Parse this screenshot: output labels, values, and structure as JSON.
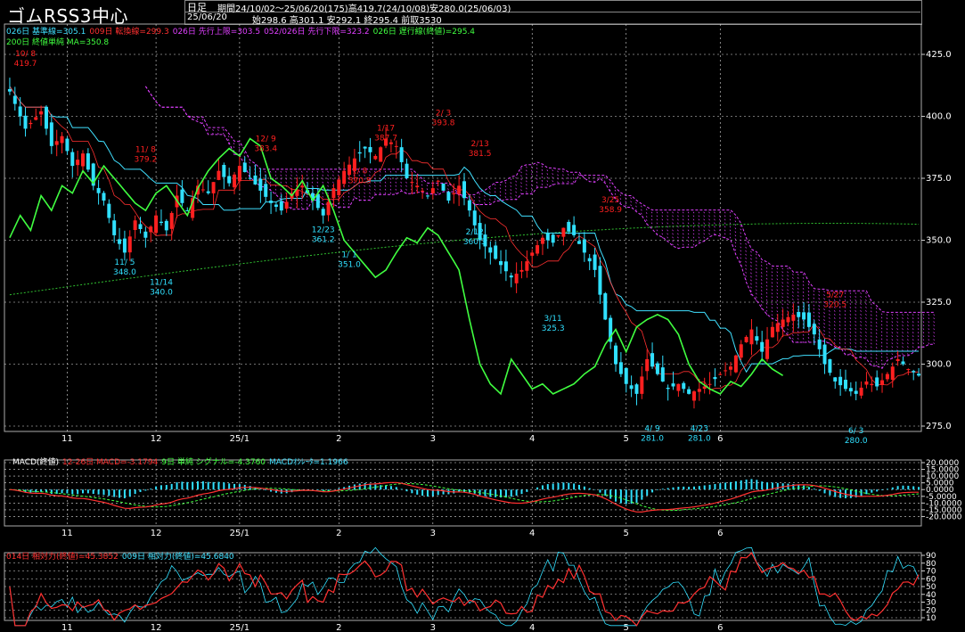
{
  "app": {
    "title": "ゴムRSS3中心",
    "bar_type": "日足",
    "summary_line1": "期間24/10/02～25/06/20(175)高419.7(24/10/08)安280.0(25/06/03)",
    "date": "25/06/20",
    "summary_line2": "始298.6 高301.1 安292.1 終295.4 前取3530"
  },
  "legend": {
    "main_row1": [
      {
        "text": "026日 基準線=305.1",
        "color": "#40e0ff"
      },
      {
        "text": "009日 転換線=299.3",
        "color": "#ff3030"
      },
      {
        "text": "026日 先行上限=303.5",
        "color": "#e040ff"
      },
      {
        "text": "052/026日 先行下限=323.2",
        "color": "#e040ff"
      },
      {
        "text": "026日 遅行線(終値)=295.4",
        "color": "#40ff40"
      }
    ],
    "main_row2": [
      {
        "text": "200日 終値単純 MA=350.8",
        "color": "#40ff40"
      }
    ],
    "macd": [
      {
        "text": "MACD(終値)",
        "color": "#ffffff"
      },
      {
        "text": "12-26日 MACD=-3.1794",
        "color": "#ff3030"
      },
      {
        "text": "9日 単純 シグナル=-4.3760",
        "color": "#40ff40"
      },
      {
        "text": "MACDｵｼﾚｰﾀ=1.1966",
        "color": "#40e0ff"
      }
    ],
    "rsi": [
      {
        "text": "014日 相対力(終値)=45.3852",
        "color": "#ff3030"
      },
      {
        "text": "009日 相対力(終値)=45.6840",
        "color": "#40e0ff"
      }
    ]
  },
  "colors": {
    "up": "#ff2020",
    "down": "#30e0ff",
    "kijun": "#40e0ff",
    "tenkan": "#ff3030",
    "chikou": "#40ff40",
    "ma": "#30c030",
    "cloud": "#e040ff",
    "grid": "#dddddd"
  },
  "chart_data": [
    {
      "type": "candlestick",
      "panel": "price",
      "ylim": [
        275,
        425
      ],
      "y_ticks": [
        "425.0",
        "400.0",
        "375.0",
        "350.0",
        "325.0",
        "300.0",
        "275.0"
      ],
      "x_ticks": [
        "11",
        "12",
        "25/1",
        "2",
        "3",
        "4",
        "5",
        "6"
      ],
      "annotations": [
        {
          "label": "10/ 8",
          "value": "419.7",
          "kind": "high"
        },
        {
          "label": "11/ 8",
          "value": "379.2",
          "kind": "high"
        },
        {
          "label": "12/ 9",
          "value": "383.4",
          "kind": "high"
        },
        {
          "label": "1/ 8",
          "value": "370.5",
          "kind": "high"
        },
        {
          "label": "1/17",
          "value": "387.7",
          "kind": "high"
        },
        {
          "label": "2/ 3",
          "value": "393.8",
          "kind": "high"
        },
        {
          "label": "2/13",
          "value": "381.5",
          "kind": "high"
        },
        {
          "label": "3/25",
          "value": "358.9",
          "kind": "high"
        },
        {
          "label": "5/27",
          "value": "320.5",
          "kind": "high"
        },
        {
          "label": "11/ 5",
          "value": "348.0",
          "kind": "low"
        },
        {
          "label": "11/14",
          "value": "340.0",
          "kind": "low"
        },
        {
          "label": "12/23",
          "value": "361.2",
          "kind": "low"
        },
        {
          "label": "1/ 1",
          "value": "351.0",
          "kind": "low"
        },
        {
          "label": "2/12",
          "value": "360.3",
          "kind": "low"
        },
        {
          "label": "3/11",
          "value": "325.3",
          "kind": "low"
        },
        {
          "label": "4/ 9",
          "value": "281.0",
          "kind": "low"
        },
        {
          "label": "4/23",
          "value": "281.0",
          "kind": "low"
        },
        {
          "label": "6/ 3",
          "value": "280.0",
          "kind": "low"
        }
      ],
      "close_anchors": [
        [
          0,
          410
        ],
        [
          3,
          395
        ],
        [
          6,
          402
        ],
        [
          8,
          388
        ],
        [
          10,
          392
        ],
        [
          12,
          380
        ],
        [
          14,
          385
        ],
        [
          16,
          372
        ],
        [
          18,
          366
        ],
        [
          20,
          352
        ],
        [
          22,
          345
        ],
        [
          24,
          358
        ],
        [
          26,
          351
        ],
        [
          28,
          360
        ],
        [
          30,
          354
        ],
        [
          32,
          368
        ],
        [
          34,
          362
        ],
        [
          36,
          372
        ],
        [
          38,
          369
        ],
        [
          40,
          378
        ],
        [
          42,
          373
        ],
        [
          44,
          380
        ],
        [
          46,
          375
        ],
        [
          48,
          370
        ],
        [
          50,
          365
        ],
        [
          52,
          362
        ],
        [
          54,
          369
        ],
        [
          56,
          372
        ],
        [
          58,
          366
        ],
        [
          60,
          360
        ],
        [
          62,
          371
        ],
        [
          64,
          378
        ],
        [
          66,
          383
        ],
        [
          68,
          387
        ],
        [
          70,
          384
        ],
        [
          72,
          391
        ],
        [
          74,
          388
        ],
        [
          76,
          375
        ],
        [
          78,
          372
        ],
        [
          80,
          368
        ],
        [
          82,
          374
        ],
        [
          84,
          366
        ],
        [
          86,
          372
        ],
        [
          88,
          362
        ],
        [
          90,
          350
        ],
        [
          92,
          345
        ],
        [
          94,
          340
        ],
        [
          96,
          335
        ],
        [
          98,
          338
        ],
        [
          100,
          345
        ],
        [
          102,
          351
        ],
        [
          104,
          349
        ],
        [
          106,
          355
        ],
        [
          108,
          352
        ],
        [
          110,
          345
        ],
        [
          112,
          338
        ],
        [
          114,
          318
        ],
        [
          116,
          300
        ],
        [
          118,
          292
        ],
        [
          120,
          288
        ],
        [
          122,
          302
        ],
        [
          124,
          296
        ],
        [
          126,
          290
        ],
        [
          128,
          292
        ],
        [
          130,
          288
        ],
        [
          132,
          290
        ],
        [
          134,
          292
        ],
        [
          136,
          296
        ],
        [
          138,
          299
        ],
        [
          140,
          308
        ],
        [
          142,
          314
        ],
        [
          144,
          305
        ],
        [
          146,
          315
        ],
        [
          148,
          318
        ],
        [
          150,
          320
        ],
        [
          152,
          318
        ],
        [
          154,
          312
        ],
        [
          156,
          300
        ],
        [
          158,
          293
        ],
        [
          160,
          290
        ],
        [
          162,
          288
        ],
        [
          164,
          293
        ],
        [
          166,
          291
        ],
        [
          168,
          296
        ],
        [
          170,
          302
        ],
        [
          172,
          298
        ],
        [
          174,
          295.4
        ]
      ],
      "series": [
        {
          "name": "026日 基準線",
          "source": "legend",
          "current": 305.1
        },
        {
          "name": "009日 転換線",
          "source": "legend",
          "current": 299.3
        },
        {
          "name": "026日 先行上限",
          "current": 303.5
        },
        {
          "name": "052/026日 先行下限",
          "current": 323.2
        },
        {
          "name": "026日 遅行線(終値)",
          "current": 295.4
        },
        {
          "name": "200日 終値単純 MA",
          "current": 350.8
        }
      ]
    },
    {
      "type": "line",
      "panel": "macd",
      "ylim": [
        -25,
        20
      ],
      "y_ticks": [
        "20.0000",
        "15.0000",
        "10.0000",
        "5.0000",
        "0.0000",
        "-5.0000",
        "-10.0000",
        "-15.0000",
        "-20.0000"
      ],
      "x_ticks": [
        "11",
        "12",
        "25/1",
        "2",
        "3",
        "4",
        "5",
        "6"
      ],
      "series": [
        {
          "name": "MACD",
          "last": -3.1794
        },
        {
          "name": "シグナル",
          "last": -4.376
        },
        {
          "name": "MACDｵｼﾚｰﾀ",
          "last": 1.1966
        }
      ]
    },
    {
      "type": "line",
      "panel": "rsi",
      "ylim": [
        10,
        90
      ],
      "y_ticks": [
        "90",
        "80",
        "70",
        "60",
        "50",
        "40",
        "30",
        "20",
        "10"
      ],
      "x_ticks": [
        "11",
        "12",
        "25/1",
        "2",
        "3",
        "4",
        "5",
        "6"
      ],
      "series": [
        {
          "name": "014日 相対力",
          "last": 45.3852
        },
        {
          "name": "009日 相対力",
          "last": 45.684
        }
      ]
    }
  ]
}
